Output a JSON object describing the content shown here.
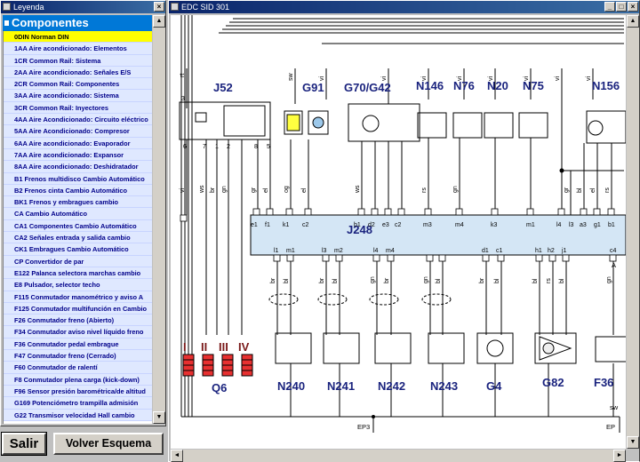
{
  "legend_window": {
    "title": "Leyenda",
    "header": "Componentes",
    "items": [
      "0DIN Norman DIN",
      "1AA  Aire acondicionado: Elementos",
      "1CR  Common Rail: Sistema",
      "2AA  Aire acondicionado: Señales E/S",
      "2CR  Common Rail: Componentes",
      "3AA  Aire acondicionado: Sistema",
      "3CR  Common Rail: Inyectores",
      "4AA  Aire Acondicionado: Circuito eléctrico",
      "5AA  Aire Acondicionado: Compresor",
      "6AA  Aire acondicionado: Evaporador",
      "7AA  Aire acondicionado: Expansor",
      "8AA  Aire acondicionado: Deshidratador",
      "B1   Frenos multidisco Cambio Automático",
      "B2   Frenos cinta Cambio Automático",
      "BK1  Frenos y embragues cambio",
      "CA   Cambio Automático",
      "CA1  Componentes Cambio Automático",
      "CA2  Señales entrada y salida cambio",
      "CK1  Embragues Cambio Automático",
      "CP   Convertidor de par",
      "E122 Palanca selectora marchas cambio",
      "E8   Pulsador, selector techo",
      "F115 Conmutador manométrico y aviso A",
      "F125 Conmutador multifunción en Cambio",
      "F26  Conmutador freno (Abierto)",
      "F34  Conmutador aviso nivel líquido freno",
      "F36  Conmutador pedal embrague",
      "F47  Conmutador freno (Cerrado)",
      "F60  Conmutador de ralentí",
      "F8   Conmutador plena carga (kick-down)",
      "F96  Sensor presión barométrica/de altitud",
      "G169 Potenciómetro trampilla admisión",
      "G22  Transmisor  velocidad Hall cambio"
    ]
  },
  "buttons": {
    "salir": "Salir",
    "volver": "Volver Esquema"
  },
  "diagram_window": {
    "title": "EDC SID 301",
    "components": {
      "j52": "J52",
      "g91": "G91",
      "g70": "G70/G42",
      "n146": "N146",
      "n76": "N76",
      "n20": "N20",
      "n75": "N75",
      "n156": "N156",
      "j248": "J248",
      "q6": "Q6",
      "n240": "N240",
      "n241": "N241",
      "n242": "N242",
      "n243": "N243",
      "g4": "G4",
      "g82": "G82",
      "f36": "F36",
      "ep3": "EP3"
    },
    "fuse_labels": [
      "I",
      "II",
      "III",
      "IV"
    ],
    "top_wire_labels": [
      "rt",
      "sw",
      "vi",
      "vi",
      "vi",
      "vi",
      "vi",
      "vi",
      "vi",
      "vi"
    ],
    "j52_pins": [
      "3",
      "6",
      "7",
      "1",
      "2",
      "8",
      "5"
    ],
    "mid_wire_colors": [
      "vi",
      "ws",
      "br",
      "gn",
      "gr",
      "el",
      "og",
      "el",
      "ws",
      "rs",
      "gn",
      "gr",
      "bl",
      "el",
      "rs"
    ],
    "upper_pins": [
      "e1",
      "f1",
      "k1",
      "c2",
      "b1",
      "d2",
      "e3",
      "c2",
      "m3",
      "m4",
      "k3",
      "m1",
      "l4",
      "l3",
      "a3",
      "g1",
      "b1"
    ],
    "lower_pins": [
      "l1",
      "m1",
      "l3",
      "m2",
      "l4",
      "m4",
      "d1",
      "c1",
      "h1",
      "h2",
      "j1",
      "c4"
    ],
    "lower_wire_colors": [
      "br",
      "bl",
      "br",
      "bl",
      "gn",
      "br",
      "gn",
      "bl",
      "br",
      "bl",
      "bl",
      "rs",
      "bl",
      "gn",
      "ws",
      "sw"
    ],
    "pin_letter": "A",
    "bottom_sw": "sw",
    "bottom_ep": "EP"
  }
}
